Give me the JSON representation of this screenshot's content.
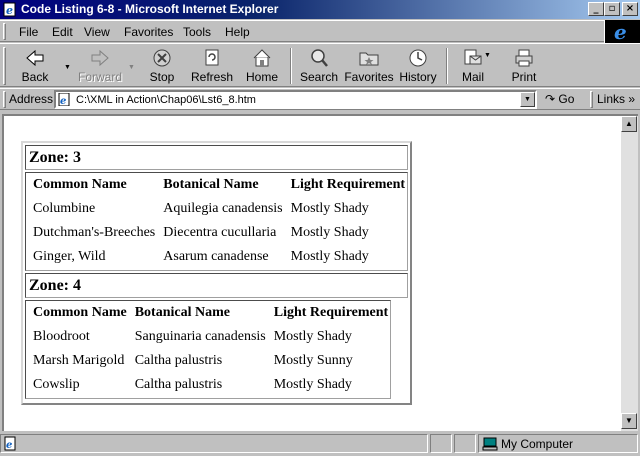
{
  "window": {
    "title": "Code Listing 6-8 - Microsoft Internet Explorer"
  },
  "menu": [
    {
      "label": "File"
    },
    {
      "label": "Edit"
    },
    {
      "label": "View"
    },
    {
      "label": "Favorites"
    },
    {
      "label": "Tools"
    },
    {
      "label": "Help"
    }
  ],
  "toolbar": {
    "back": "Back",
    "forward": "Forward",
    "stop": "Stop",
    "refresh": "Refresh",
    "home": "Home",
    "search": "Search",
    "favorites": "Favorites",
    "history": "History",
    "mail": "Mail",
    "print": "Print"
  },
  "address": {
    "label": "Address",
    "value": "C:\\XML in Action\\Chap06\\Lst6_8.htm",
    "go": "Go",
    "links": "Links"
  },
  "zones": [
    {
      "title": "Zone: 3",
      "headers": [
        "Common Name",
        "Botanical Name",
        "Light Requirement"
      ],
      "rows": [
        [
          "Columbine",
          "Aquilegia canadensis",
          "Mostly Shady"
        ],
        [
          "Dutchman's-Breeches",
          "Diecentra cucullaria",
          "Mostly Shady"
        ],
        [
          "Ginger, Wild",
          "Asarum canadense",
          "Mostly Shady"
        ]
      ]
    },
    {
      "title": "Zone: 4",
      "headers": [
        "Common Name",
        "Botanical Name",
        "Light Requirement"
      ],
      "rows": [
        [
          "Bloodroot",
          "Sanguinaria canadensis",
          "Mostly Shady"
        ],
        [
          "Marsh Marigold",
          "Caltha palustris",
          "Mostly Sunny"
        ],
        [
          "Cowslip",
          "Caltha palustris",
          "Mostly Shady"
        ]
      ]
    }
  ],
  "status": {
    "zone": "My Computer"
  },
  "colors": {
    "titlebar": "#000080",
    "chrome": "#c0c0c0",
    "page": "#ffffff"
  }
}
